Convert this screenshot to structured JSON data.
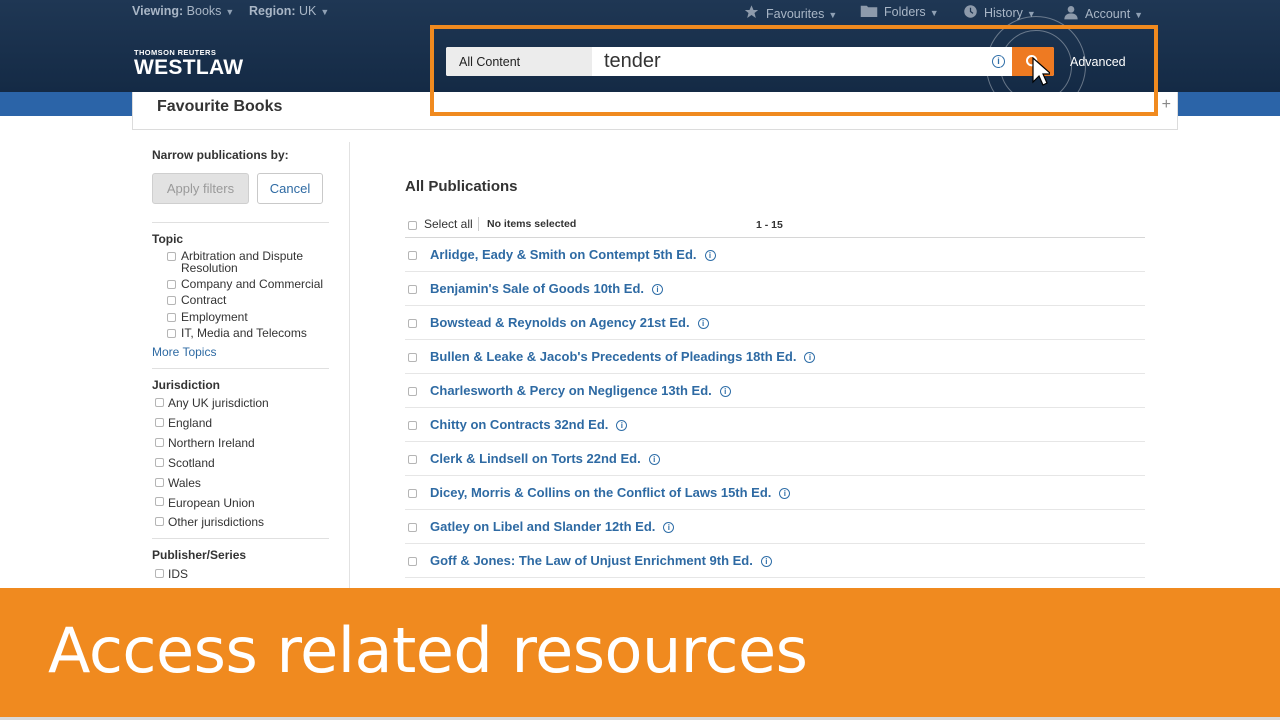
{
  "topbar": {
    "viewing_label": "Viewing:",
    "viewing_value": "Books",
    "region_label": "Region:",
    "region_value": "UK",
    "favourites": "Favourites",
    "folders": "Folders",
    "history": "History",
    "account": "Account"
  },
  "brand": {
    "company": "THOMSON REUTERS",
    "product": "WESTLAW"
  },
  "search": {
    "scope": "All Content",
    "query": "tender",
    "info": "i",
    "advanced": "Advanced"
  },
  "panel": {
    "title": "Favourite Books",
    "plus": "+"
  },
  "facets": {
    "narrow_label": "Narrow publications by:",
    "apply": "Apply filters",
    "cancel": "Cancel",
    "topic_heading": "Topic",
    "topics": [
      "Arbitration and Dispute",
      "Resolution",
      "Company and Commercial",
      "Contract",
      "Employment",
      "IT, Media and Telecoms"
    ],
    "more_topics": "More Topics",
    "jurisdiction_heading": "Jurisdiction",
    "jurisdictions": [
      "Any UK jurisdiction",
      "England",
      "Northern Ireland",
      "Scotland",
      "Wales",
      "European Union",
      "Other jurisdictions"
    ],
    "publisher_heading": "Publisher/Series",
    "publishers": [
      "IDS"
    ]
  },
  "main": {
    "heading": "All Publications",
    "select_all": "Select all",
    "no_items": "No items selected",
    "range": "1 - 15",
    "items": [
      "Arlidge, Eady & Smith on Contempt 5th Ed.",
      "Benjamin's Sale of Goods 10th Ed.",
      "Bowstead & Reynolds on Agency 21st Ed.",
      "Bullen & Leake & Jacob's Precedents of Pleadings 18th Ed.",
      "Charlesworth & Percy on Negligence 13th Ed.",
      "Chitty on Contracts 32nd Ed.",
      "Clerk & Lindsell on Torts 22nd Ed.",
      "Dicey, Morris & Collins on the Conflict of Laws 15th Ed.",
      "Gatley on Libel and Slander 12th Ed.",
      "Goff & Jones: The Law of Unjust Enrichment 9th Ed."
    ],
    "info_glyph": "i"
  },
  "banner": {
    "text": "Access related resources"
  },
  "colors": {
    "header": "#1a3150",
    "accent_orange": "#f08a1f",
    "link_blue": "#2e6aa3",
    "band_blue": "#2b64a8"
  }
}
